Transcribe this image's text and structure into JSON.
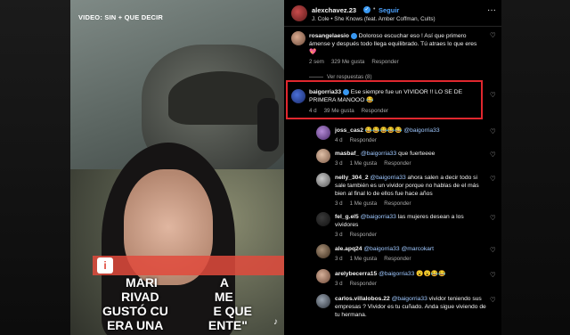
{
  "video": {
    "tag": "VIDEO: SIN + QUE DECIR",
    "banner_icon": "i",
    "subtitle_lines": [
      "MARI                  A",
      "RIVAD                ME",
      "GUSTÓ CU             E QUE",
      "ERA UNA             ENTE\""
    ]
  },
  "post_header": {
    "username": "alexchavez.23",
    "follow": "Seguir",
    "song": "J. Cole • She Knows (feat. Amber Coffman, Cults)"
  },
  "comments": [
    {
      "user": "rosangelaesio",
      "text": "Doloroso escuchar eso ! Así que primero ámense y después todo llega equilibrado. Tú atraes lo que eres",
      "emoji": "💖",
      "time": "2 sem",
      "likes": "329 Me gusta",
      "reply": "Responder",
      "view_replies": "Ver respuestas (8)"
    },
    {
      "user": "baigorria33",
      "text": "Ese siempre fue un VIVIDOR !! LO SE DE PRIMERA MANOOO",
      "emoji": "😂",
      "time": "4 d",
      "likes": "39 Me gusta",
      "reply": "Responder"
    },
    {
      "user": "joss_cas2",
      "text": "😂😂😂😂😂",
      "mention": "@baigorria33",
      "time": "4 d",
      "reply": "Responder"
    },
    {
      "user": "masbaf_",
      "mention": "@baigorria33",
      "text": "que fuerteeee",
      "time": "3 d",
      "likes": "1 Me gusta",
      "reply": "Responder"
    },
    {
      "user": "nelly_304_2",
      "mention": "@baigorria33",
      "text": "ahora salen a decir todo si sale también es un vividor porque no hablas de el más bien al final lo de ellos fue hace años",
      "time": "3 d",
      "likes": "1 Me gusta",
      "reply": "Responder"
    },
    {
      "user": "fel_g.el5",
      "mention": "@baigorria33",
      "text": "las mujeres desean a los vividores",
      "time": "3 d",
      "reply": "Responder"
    },
    {
      "user": "ale.apq24",
      "mention1": "@baigorria33",
      "mention2": "@marcokart",
      "time": "3 d",
      "likes": "1 Me gusta",
      "reply": "Responder"
    },
    {
      "user": "arelybecerra15",
      "mention": "@baigorria33",
      "text": "😮😮😂😂",
      "time": "3 d",
      "reply": "Responder"
    },
    {
      "user": "carlos.villalobos.22",
      "mention": "@baigorria33",
      "text": "vividor teniendo sus empresas ? Vividor es tu cuñado. Anda sigue viviendo de tu hermana."
    }
  ]
}
